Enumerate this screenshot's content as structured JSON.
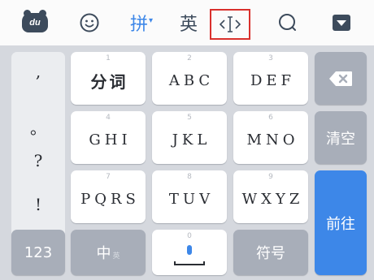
{
  "toolbar": {
    "logo_text": "du",
    "pinyin_label": "拼",
    "pinyin_caret": "▾",
    "english_label": "英",
    "cursor_label": "‹I›",
    "icons": [
      "du-logo-icon",
      "emoji-icon",
      "cursor-move-icon",
      "search-icon",
      "hide-keyboard-icon"
    ],
    "highlight_color": "#d9302c"
  },
  "punctuation": [
    ",",
    "。",
    "?",
    "!"
  ],
  "keys": {
    "row1": [
      {
        "num": "1",
        "label": "分词"
      },
      {
        "num": "2",
        "label": "ABC"
      },
      {
        "num": "3",
        "label": "DEF"
      }
    ],
    "row2": [
      {
        "num": "4",
        "label": "GHI"
      },
      {
        "num": "5",
        "label": "JKL"
      },
      {
        "num": "6",
        "label": "MNO"
      }
    ],
    "row3": [
      {
        "num": "7",
        "label": "PQRS"
      },
      {
        "num": "8",
        "label": "TUV"
      },
      {
        "num": "9",
        "label": "WXYZ"
      }
    ],
    "space_num": "0",
    "num_switch": "123",
    "lang_switch": "中",
    "lang_switch_sub": "英",
    "symbol": "符号",
    "clear": "清空",
    "go": "前往"
  },
  "colors": {
    "accent_blue": "#3d87e8",
    "function_key_gray": "#a8aeb9",
    "keyboard_bg": "#d5d8de"
  }
}
